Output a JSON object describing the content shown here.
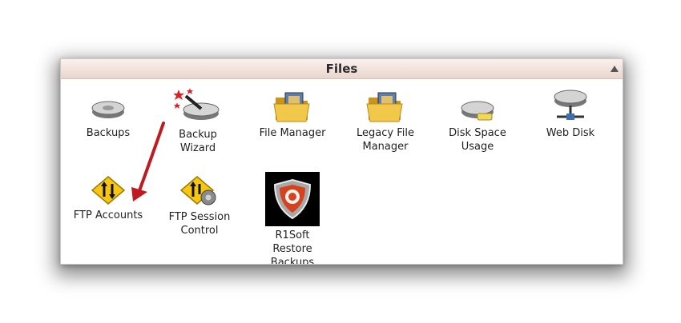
{
  "section": {
    "title": "Files"
  },
  "items": [
    {
      "label_lines": [
        "Backups"
      ],
      "icon": "disk-drive-icon"
    },
    {
      "label_lines": [
        "Backup",
        "Wizard"
      ],
      "icon": "magic-wand-icon"
    },
    {
      "label_lines": [
        "File Manager"
      ],
      "icon": "folder-icon"
    },
    {
      "label_lines": [
        "Legacy File",
        "Manager"
      ],
      "icon": "folder-icon"
    },
    {
      "label_lines": [
        "Disk Space",
        "Usage"
      ],
      "icon": "disk-usage-icon"
    },
    {
      "label_lines": [
        "Web Disk"
      ],
      "icon": "network-disk-icon"
    },
    {
      "label_lines": [
        "FTP Accounts"
      ],
      "icon": "ftp-transfer-icon"
    },
    {
      "label_lines": [
        "FTP Session",
        "Control"
      ],
      "icon": "ftp-session-icon"
    },
    {
      "label_lines": [
        "R1Soft",
        "Restore",
        "Backups"
      ],
      "icon": "r1soft-shield-icon"
    }
  ],
  "colors": {
    "header_bg": "#efe0d8",
    "arrow": "#c0191f",
    "ftp_icon": "#f6c613"
  }
}
